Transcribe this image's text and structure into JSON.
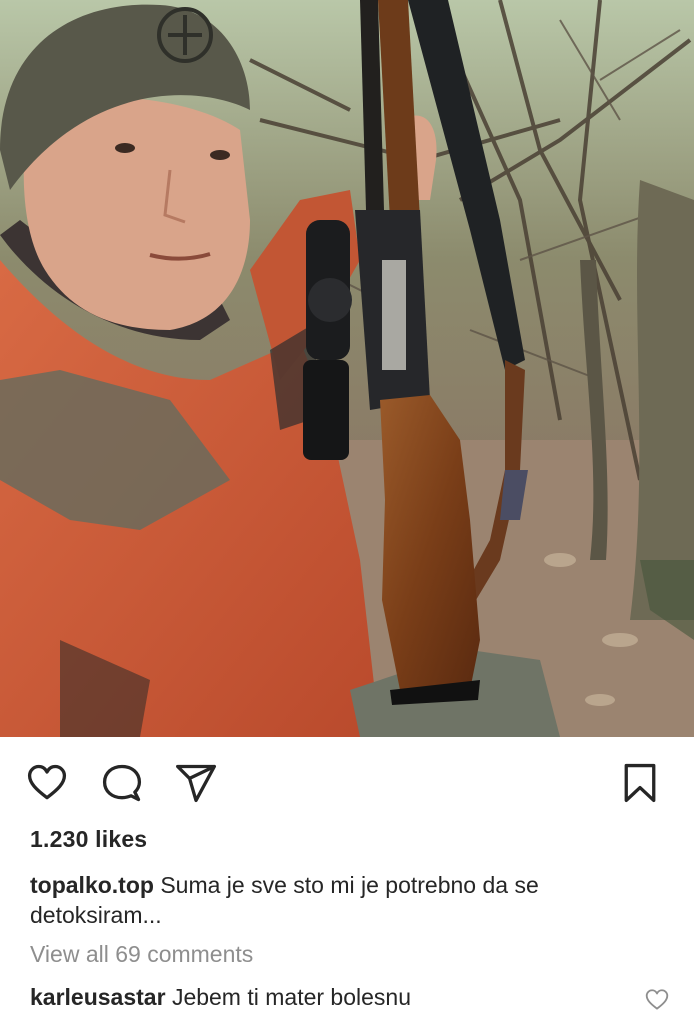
{
  "post": {
    "image_alt": "Man in green beanie and orange jacket holding a scoped hunting rifle in a forest",
    "likes": "1.230 likes",
    "caption": {
      "username": "topalko.top",
      "text": "Suma je sve sto mi je potrebno da se detoksiram..."
    },
    "view_comments": "View all 69 comments",
    "comment": {
      "username": "karleusastar",
      "text": "Jebem ti mater bolesnu"
    }
  },
  "icons": {
    "like": "heart-icon",
    "comment": "comment-bubble-icon",
    "share": "paper-plane-icon",
    "save": "bookmark-icon",
    "comment_like": "heart-small-icon"
  },
  "colors": {
    "text": "#262626",
    "muted": "#8e8e8e",
    "background": "#ffffff"
  }
}
